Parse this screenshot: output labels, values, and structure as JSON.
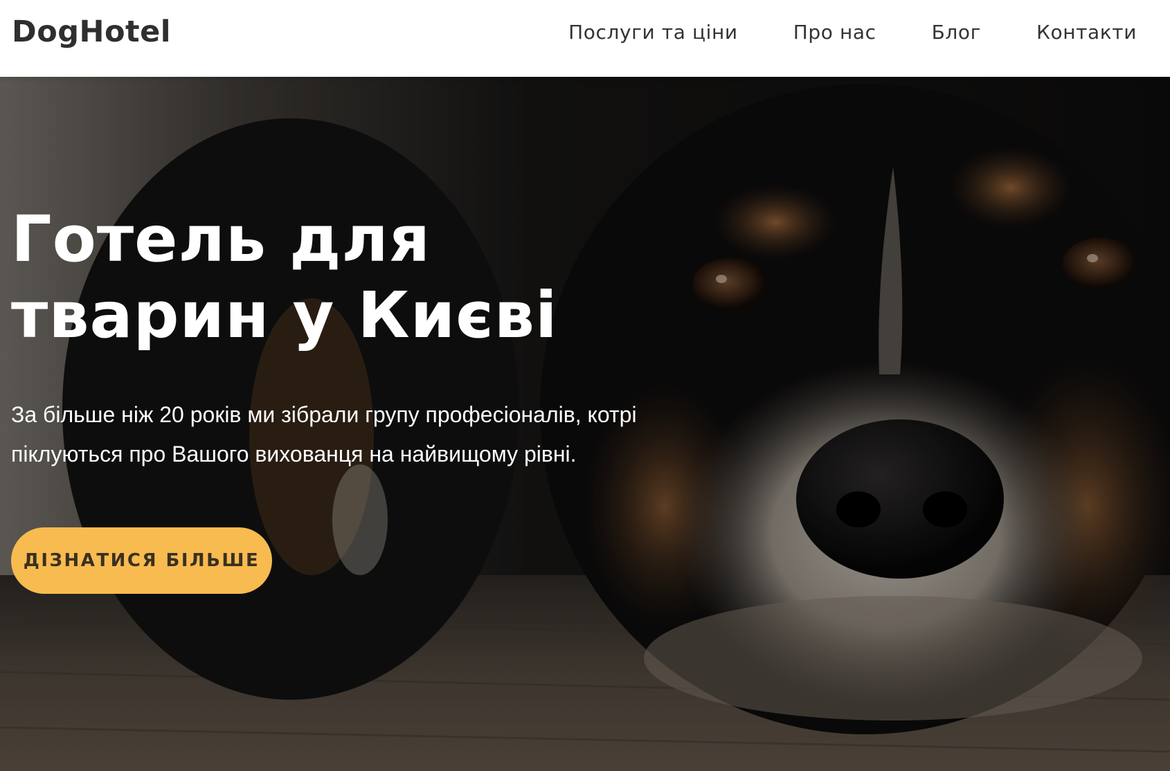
{
  "header": {
    "logo": "DogHotel",
    "nav": [
      "Послуги та ціни",
      "Про нас",
      "Блог",
      "Контакти"
    ]
  },
  "hero": {
    "title": "Готель для тварин у Києві",
    "subtitle": "За більше ніж 20 років ми зібрали групу професіоналів, котрі піклуються про Вашого вихованця на найвищому рівні.",
    "cta": "ДІЗНАТИСЯ БІЛЬШЕ",
    "background": "dog-photo"
  },
  "colors": {
    "accent": "#f7bb50",
    "text_dark": "#333333",
    "hero_text": "#ffffff"
  }
}
